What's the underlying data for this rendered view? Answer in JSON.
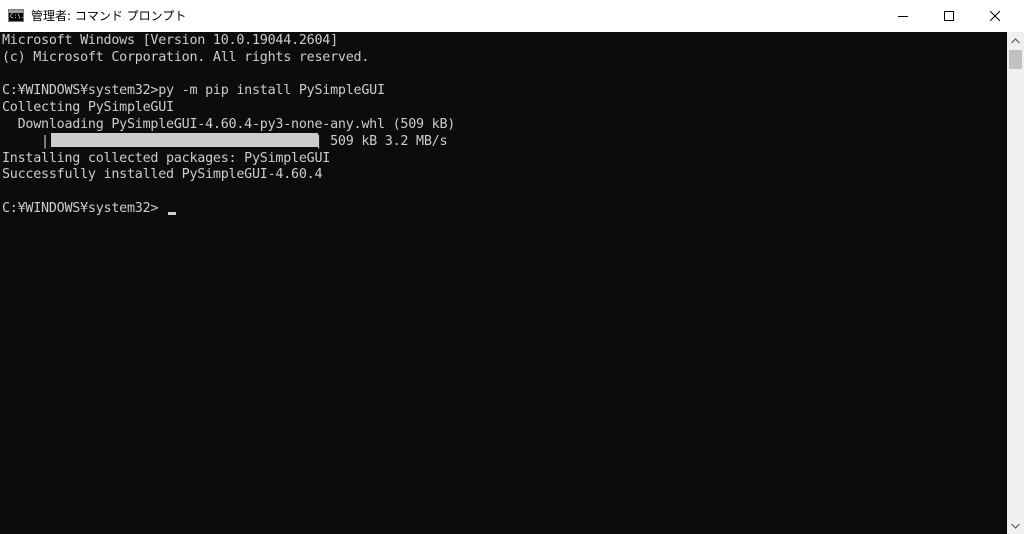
{
  "window": {
    "title": "管理者: コマンド プロンプト",
    "icon_text": "C:\\."
  },
  "controls": {
    "minimize_icon": "minimize-icon",
    "maximize_icon": "maximize-icon",
    "close_icon": "close-icon"
  },
  "console": {
    "lines": [
      "Microsoft Windows [Version 10.0.19044.2604]",
      "(c) Microsoft Corporation. All rights reserved.",
      "",
      "C:¥WINDOWS¥system32>py -m pip install PySimpleGUI",
      "Collecting PySimpleGUI",
      "  Downloading PySimpleGUI-4.60.4-py3-none-any.whl (509 kB)",
      "     |                                  | 509 kB 3.2 MB/s",
      "Installing collected packages: PySimpleGUI",
      "Successfully installed PySimpleGUI-4.60.4",
      "",
      "C:¥WINDOWS¥system32>"
    ],
    "download_progress": 1.0
  },
  "colors": {
    "background": "#0c0c0c",
    "foreground": "#cccccc",
    "titlebar": "#ffffff"
  }
}
